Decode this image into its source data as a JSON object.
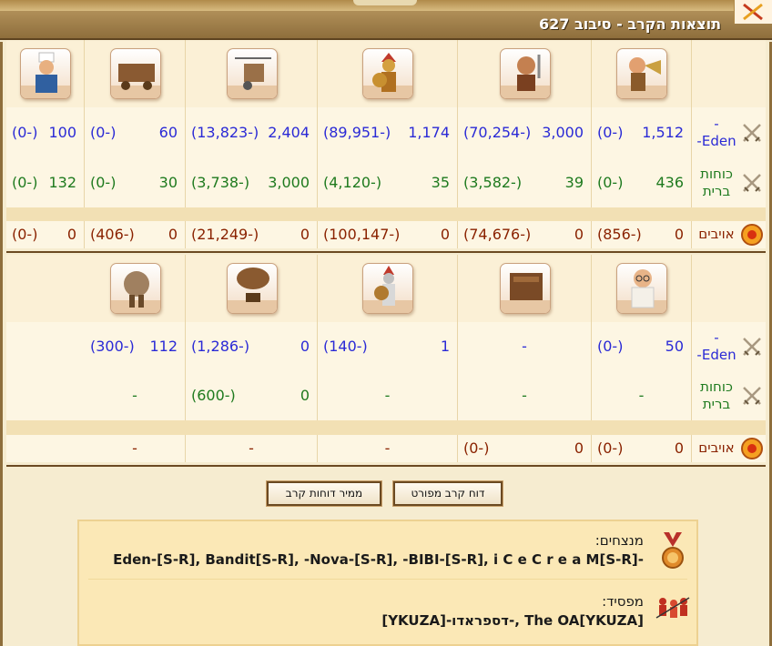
{
  "title": "תוצאות הקרב - סיבוב 627",
  "colors": {
    "own": "#2a2ad6",
    "allies": "#1e7a1e",
    "enemies": "#8a2200"
  },
  "row_icons": {
    "own": "crossed-swords-icon",
    "allies": "crossed-swords-icon",
    "enemies": "shield-emblem-icon"
  },
  "section1": {
    "units": [
      "trumpeter-unit",
      "barbarian-unit",
      "hoplite-unit",
      "gyrocopter-unit",
      "ram-unit",
      "chef-unit"
    ],
    "own": {
      "label": "-Eden-",
      "cells": [
        [
          "1,512",
          "(0-)"
        ],
        [
          "3,000",
          "(70,254-)"
        ],
        [
          "1,174",
          "(89,951-)"
        ],
        [
          "2,404",
          "(13,823-)"
        ],
        [
          "60",
          "(0-)"
        ],
        [
          "100",
          "(0-)"
        ]
      ]
    },
    "allies": {
      "label": "כוחות ברית",
      "cells": [
        [
          "436",
          "(0-)"
        ],
        [
          "39",
          "(3,582-)"
        ],
        [
          "35",
          "(4,120-)"
        ],
        [
          "3,000",
          "(3,738-)"
        ],
        [
          "30",
          "(0-)"
        ],
        [
          "132",
          "(0-)"
        ]
      ]
    },
    "enemies": {
      "label": "אויבים",
      "cells": [
        [
          "0",
          "(856-)"
        ],
        [
          "0",
          "(74,676-)"
        ],
        [
          "0",
          "(100,147-)"
        ],
        [
          "0",
          "(21,249-)"
        ],
        [
          "0",
          "(406-)"
        ],
        [
          "0",
          "(0-)"
        ]
      ]
    }
  },
  "section2": {
    "units": [
      "doctor-unit",
      "battering-ram-unit",
      "phalanx-unit",
      "balloon-bomber-unit",
      "steam-giant-unit"
    ],
    "own": {
      "label": "-Eden-",
      "cells": [
        [
          "50",
          "(0-)"
        ],
        [
          "-",
          ""
        ],
        [
          "1",
          "(140-)"
        ],
        [
          "0",
          "(1,286-)"
        ],
        [
          "112",
          "(300-)"
        ]
      ]
    },
    "allies": {
      "label": "כוחות ברית",
      "cells": [
        [
          "-",
          ""
        ],
        [
          "-",
          ""
        ],
        [
          "-",
          ""
        ],
        [
          "0",
          "(600-)"
        ],
        [
          "-",
          ""
        ]
      ]
    },
    "enemies": {
      "label": "אויבים",
      "cells": [
        [
          "0",
          "(0-)"
        ],
        [
          "0",
          "(0-)"
        ],
        [
          "-",
          ""
        ],
        [
          "-",
          ""
        ],
        [
          "-",
          ""
        ]
      ]
    }
  },
  "buttons": {
    "detailed_report": "דוח קרב מפורט",
    "report_converter": "ממיר דוחות קרב"
  },
  "winners": {
    "label": "מנצחים:",
    "value": "Eden-[S-R], Bandit[S-R], -Nova-[S-R], -BIBI-[S-R], i C e C r e a M[S-R]-"
  },
  "losers": {
    "label": "מפסיד:",
    "value": "[YKUZA]-דספראדו-, The OA[YKUZA]"
  }
}
